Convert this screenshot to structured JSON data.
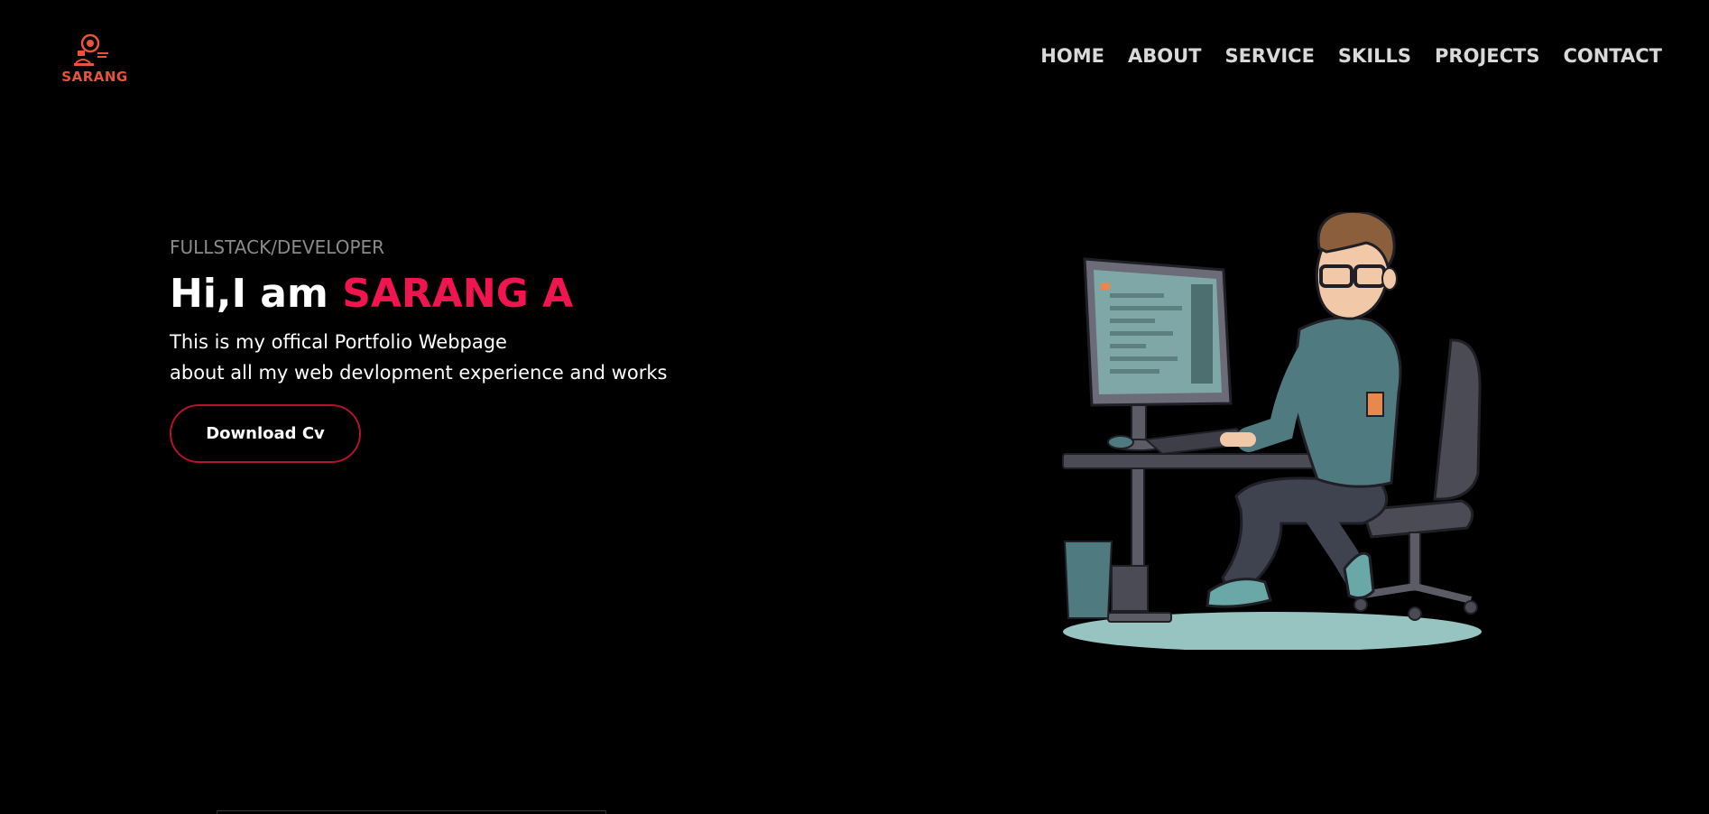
{
  "brand": {
    "logo_text": "SARANG",
    "logo_color": "#e8533a"
  },
  "nav": {
    "items": [
      {
        "label": "HOME"
      },
      {
        "label": "ABOUT"
      },
      {
        "label": "SERVICE"
      },
      {
        "label": "SKILLS"
      },
      {
        "label": "PROJECTS"
      },
      {
        "label": "CONTACT"
      }
    ]
  },
  "hero": {
    "subtitle": "FULLSTACK/DEVELOPER",
    "greeting": "Hi,I am",
    "name": "SARANG A",
    "description_line1": "This is my offical Portfolio Webpage",
    "description_line2": "about all my web devlopment experience and works",
    "cta_label": "Download Cv",
    "illustration_icon": "developer-at-desk-illustration"
  },
  "colors": {
    "accent": "#f0144f",
    "background": "#000000",
    "button_border": "#b5122e"
  }
}
